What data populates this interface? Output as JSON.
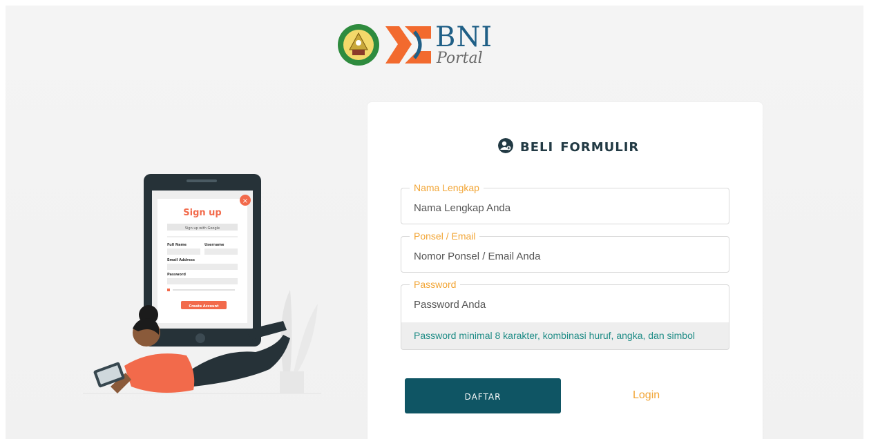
{
  "header": {
    "brand_name": "BNI",
    "brand_sub": "Portal"
  },
  "form": {
    "title": "BELI FORMULIR",
    "fields": [
      {
        "label": "Nama Lengkap",
        "placeholder": "Nama Lengkap Anda"
      },
      {
        "label": "Ponsel / Email",
        "placeholder": "Nomor Ponsel / Email Anda"
      },
      {
        "label": "Password",
        "placeholder": "Password Anda"
      }
    ],
    "password_hint": "Password minimal 8 karakter, kombinasi huruf, angka, dan simbol",
    "submit_label": "DAFTAR",
    "login_label": "Login"
  },
  "illustration": {
    "signup_title": "Sign up",
    "google_label": "Sign up with Google",
    "full_name": "Full Name",
    "username": "Username",
    "email": "Email Address",
    "password": "Password",
    "create_account": "Create Account"
  },
  "colors": {
    "accent": "#f2a535",
    "primary": "#0f5564",
    "hint": "#1f8c86",
    "title": "#223a44"
  }
}
